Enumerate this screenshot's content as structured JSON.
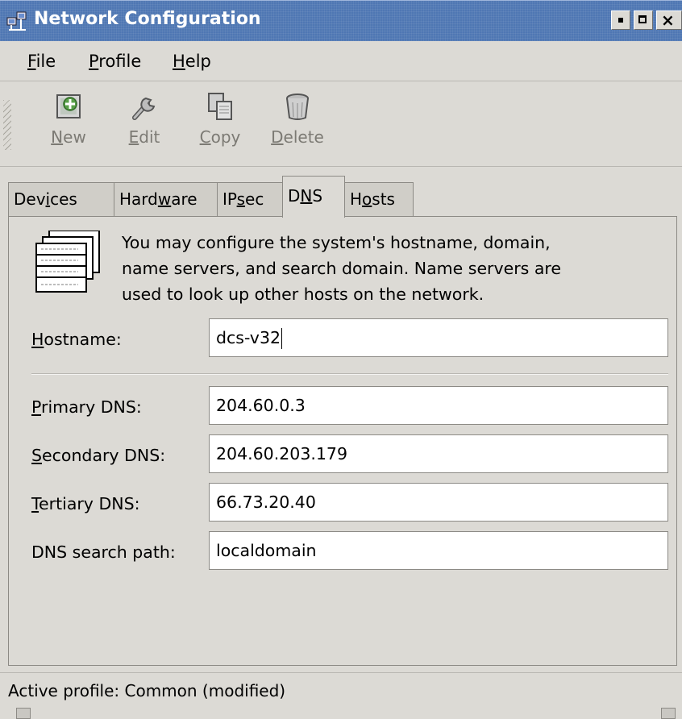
{
  "window": {
    "title": "Network Configuration",
    "icon": "network-config-icon",
    "controls": [
      "minimize",
      "maximize",
      "close"
    ]
  },
  "menu": {
    "file": {
      "mnemonic": "F",
      "rest": "ile"
    },
    "profile": {
      "mnemonic": "P",
      "rest": "rofile"
    },
    "help": {
      "mnemonic": "H",
      "rest": "elp"
    }
  },
  "toolbar": {
    "new": {
      "mnemonic": "N",
      "rest": "ew",
      "icon": "new-device-icon"
    },
    "edit": {
      "mnemonic": "E",
      "rest": "dit",
      "icon": "wrench-icon"
    },
    "copy": {
      "mnemonic": "C",
      "rest": "opy",
      "icon": "copy-icon"
    },
    "delete": {
      "mnemonic": "D",
      "rest": "elete",
      "icon": "trash-icon"
    }
  },
  "tabs": {
    "devices": {
      "pre": "Dev",
      "mn": "i",
      "post": "ces"
    },
    "hardware": {
      "pre": "Hard",
      "mn": "w",
      "post": "are"
    },
    "ipsec": {
      "pre": "IP",
      "mn": "s",
      "post": "ec"
    },
    "dns": {
      "pre": "D",
      "mn": "N",
      "post": "S"
    },
    "hosts": {
      "pre": "H",
      "mn": "o",
      "post": "sts"
    },
    "active": "dns"
  },
  "dns_panel": {
    "info": "You may configure the system's hostname, domain, name servers, and search domain. Name servers are used to look up other hosts on the network.",
    "info_lines": [
      "You may configure the system's hostname, domain,",
      "name servers, and search domain. Name servers are",
      "used to look up other hosts on the network."
    ],
    "icon": "dns-table-icon",
    "hostname": {
      "mnemonic": "H",
      "rest": "ostname:",
      "value": "dcs-v32"
    },
    "primary_dns": {
      "mnemonic": "P",
      "rest": "rimary DNS:",
      "value": "204.60.0.3"
    },
    "secondary_dns": {
      "mnemonic": "S",
      "rest": "econdary DNS:",
      "value": "204.60.203.179"
    },
    "tertiary_dns": {
      "mnemonic": "T",
      "rest": "ertiary DNS:",
      "value": "66.73.20.40"
    },
    "search_path": {
      "label": "DNS search path:",
      "value": "localdomain"
    }
  },
  "status": {
    "text": "Active profile: Common (modified)"
  }
}
